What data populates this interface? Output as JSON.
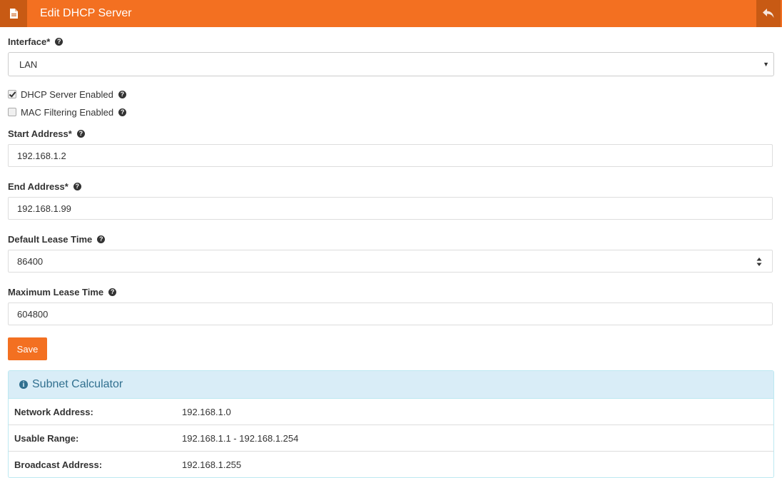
{
  "header": {
    "title": "Edit DHCP Server",
    "left_icon": "document-icon",
    "right_icon": "back-arrow-icon",
    "color": "#f37021"
  },
  "form": {
    "interface": {
      "label": "Interface*",
      "value": "LAN"
    },
    "dhcp_enabled": {
      "label": "DHCP Server Enabled",
      "checked": true
    },
    "mac_filtering": {
      "label": "MAC Filtering Enabled",
      "checked": false
    },
    "start_address": {
      "label": "Start Address*",
      "value": "192.168.1.2"
    },
    "end_address": {
      "label": "End Address*",
      "value": "192.168.1.99"
    },
    "default_lease": {
      "label": "Default Lease Time",
      "value": "86400"
    },
    "max_lease": {
      "label": "Maximum Lease Time",
      "value": "604800"
    },
    "save_label": "Save"
  },
  "subnet": {
    "title": "Subnet Calculator",
    "rows": [
      {
        "label": "Network Address:",
        "value": "192.168.1.0"
      },
      {
        "label": "Usable Range:",
        "value": "192.168.1.1 - 192.168.1.254"
      },
      {
        "label": "Broadcast Address:",
        "value": "192.168.1.255"
      }
    ]
  }
}
